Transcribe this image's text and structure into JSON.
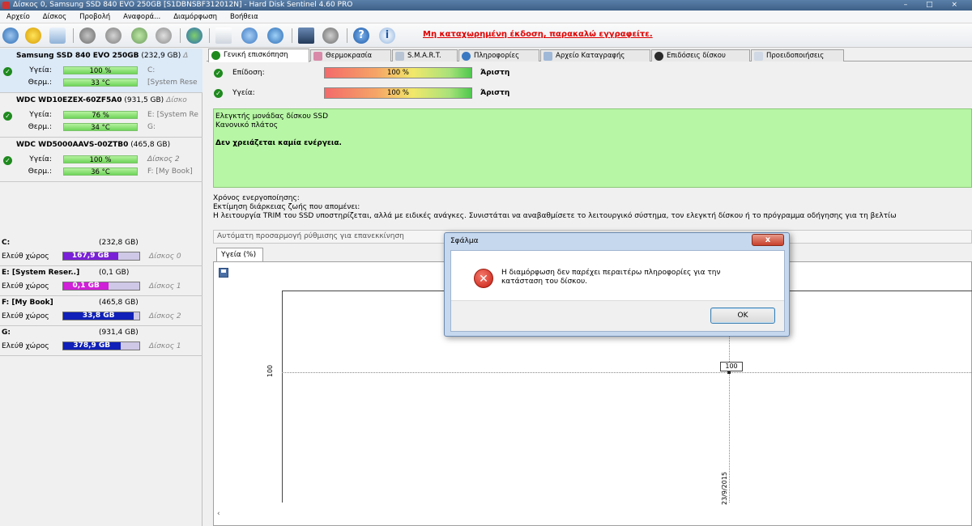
{
  "window": {
    "title": "Δίσκος 0, Samsung SSD 840 EVO 250GB [S1DBNSBF312012N]  -  Hard Disk Sentinel 4.60 PRO",
    "controls": "– □ ×"
  },
  "menu": [
    "Αρχείο",
    "Δίσκος",
    "Προβολή",
    "Αναφορά...",
    "Διαμόρφωση",
    "Βοήθεια"
  ],
  "toolbar": {
    "register_link": "Μη καταχωρημένη έκδοση, παρακαλώ εγγραφείτε.",
    "help_glyph": "?",
    "info_glyph": "i"
  },
  "disks": [
    {
      "name": "Samsung SSD 840 EVO 250GB",
      "size": "(232,9 GB)",
      "suffix": "Δ",
      "health_label": "Υγεία:",
      "health": "100 %",
      "health_extra": "C:",
      "temp_label": "Θερμ.:",
      "temp": "33 °C",
      "temp_extra": "[System Rese"
    },
    {
      "name": "WDC WD10EZEX-60ZF5A0",
      "size": "(931,5 GB)",
      "suffix": "Δίσκο",
      "health_label": "Υγεία:",
      "health": "76 %",
      "health_extra": "E: [System Re",
      "temp_label": "Θερμ.:",
      "temp": "34 °C",
      "temp_extra": "G:"
    },
    {
      "name": "WDC WD5000AAVS-00ZTB0",
      "size": "(465,8 GB)",
      "suffix": "",
      "health_label": "Υγεία:",
      "health": "100 %",
      "health_extra": "Δίσκος 2",
      "temp_label": "Θερμ.:",
      "temp": "36 °C",
      "temp_extra": "F: [My Book]"
    }
  ],
  "volumes": [
    {
      "name": "C:",
      "size": "(232,8 GB)",
      "free_label": "Ελεύθ χώρος",
      "free": "167,9 GB",
      "disk": "Δίσκος 0",
      "fill_pct": 72,
      "color": "#7a20d8"
    },
    {
      "name": "E: [System Reser..]",
      "size": "(0,1 GB)",
      "free_label": "Ελεύθ χώρος",
      "free": "0,1 GB",
      "disk": "Δίσκος 1",
      "fill_pct": 60,
      "color": "#d020d8"
    },
    {
      "name": "F: [My Book]",
      "size": "(465,8 GB)",
      "free_label": "Ελεύθ χώρος",
      "free": "33,8 GB",
      "disk": "Δίσκος 2",
      "fill_pct": 93,
      "color": "#1020b8"
    },
    {
      "name": "G:",
      "size": "(931,4 GB)",
      "free_label": "Ελεύθ χώρος",
      "free": "378,9 GB",
      "disk": "Δίσκος 1",
      "fill_pct": 75,
      "color": "#1020b8"
    }
  ],
  "tabs": [
    "Γενική επισκόπηση",
    "Θερμοκρασία",
    "S.M.A.R.T.",
    "Πληροφορίες",
    "Αρχείο Καταγραφής",
    "Επιδόσεις δίσκου",
    "Προειδοποιήσεις"
  ],
  "overview": {
    "performance_label": "Επίδοση:",
    "performance_value": "100 %",
    "performance_rating": "Άριστη",
    "health_label": "Υγεία:",
    "health_value": "100 %",
    "health_rating": "Άριστη",
    "status_line1": "Ελεγκτής μονάδας δίσκου SSD",
    "status_line2": "Κανονικό πλάτος",
    "status_line3": "Δεν χρειάζεται καμία ενέργεια.",
    "power_on": "Χρόνος ενεργοποίησης:",
    "lifetime": "Εκτίμηση διάρκειας ζωής που απομένει:",
    "trim": "Η λειτουργία TRIM του SSD υποστηρίζεται, αλλά με ειδικές ανάγκες. Συνιστάται να αναβαθμίσετε το λειτουργικό σύστημα, τον ελεγκτή δίσκου ή το πρόγραμμα οδήγησης για τη βελτίω",
    "auto_adjust": "Αυτόματη προσαρμογή ρύθμισης για επανεκκίνηση"
  },
  "chart_tab": "Υγεία (%)",
  "chart_data": {
    "type": "line",
    "x": [
      "23/9/2015"
    ],
    "series": [
      {
        "values": [
          100
        ]
      }
    ],
    "ytick": "100",
    "data_label": "100"
  },
  "scroll_left": "‹",
  "dialog": {
    "title": "Σφάλμα",
    "close": "x",
    "error_glyph": "✕",
    "message": "Η διαμόρφωση δεν παρέχει περαιτέρω πληροφορίες για την κατάσταση του δίσκου.",
    "ok": "OK"
  }
}
